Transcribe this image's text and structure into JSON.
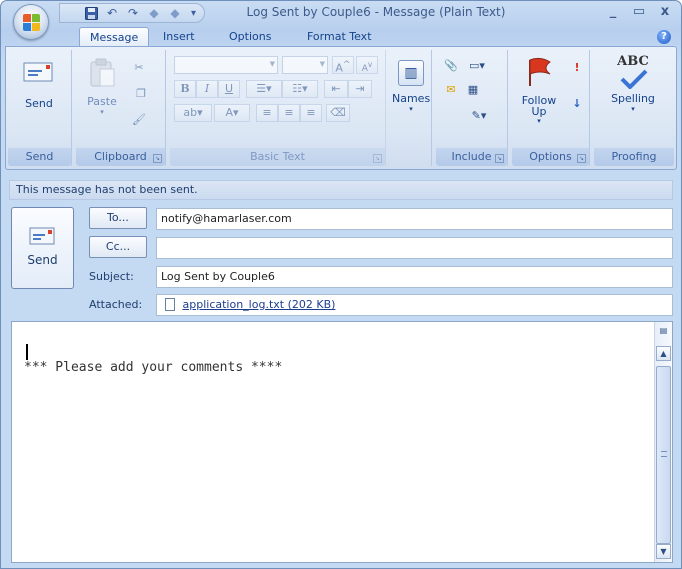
{
  "window": {
    "title": "Log Sent by Couple6 - Message (Plain Text)",
    "minimize": "_",
    "maximize": "▭",
    "close": "x"
  },
  "quick_access": {
    "save_icon": "save-icon",
    "undo_icon": "undo-icon",
    "redo_icon": "redo-icon",
    "prev_icon": "previous-item-icon",
    "next_icon": "next-item-icon",
    "customize": "▾"
  },
  "tabs": [
    "Message",
    "Insert",
    "Options",
    "Format Text"
  ],
  "active_tab": "Message",
  "ribbon": {
    "send_group": {
      "button_label": "Send",
      "group_label": "Send"
    },
    "clipboard_group": {
      "paste_label": "Paste",
      "group_label": "Clipboard"
    },
    "basic_text_group": {
      "group_label": "Basic Text",
      "bold": "B",
      "italic": "I",
      "underline": "U",
      "font_color": "A",
      "highlight": "ab",
      "grow_font": "A",
      "shrink_font": "A"
    },
    "names_group": {
      "button_label": "Names"
    },
    "include_group": {
      "group_label": "Include"
    },
    "options_group": {
      "follow_up_label": "Follow Up",
      "group_label": "Options"
    },
    "proofing_group": {
      "spelling_label": "Spelling",
      "abc": "ABC",
      "group_label": "Proofing"
    }
  },
  "message": {
    "info_bar": "This message has not been sent.",
    "send_label": "Send",
    "to_button": "To...",
    "cc_button": "Cc...",
    "to_value": "notify@hamarlaser.com",
    "cc_value": "",
    "subject_label": "Subject:",
    "subject_value": "Log Sent by Couple6",
    "attached_label": "Attached:",
    "attachment": "application_log.txt (202 KB)",
    "body": "*** Please add your comments ****"
  },
  "colors": {
    "accent": "#15428b",
    "ribbon_bg": "#dbe6f4",
    "frame": "#c4d9f2"
  }
}
